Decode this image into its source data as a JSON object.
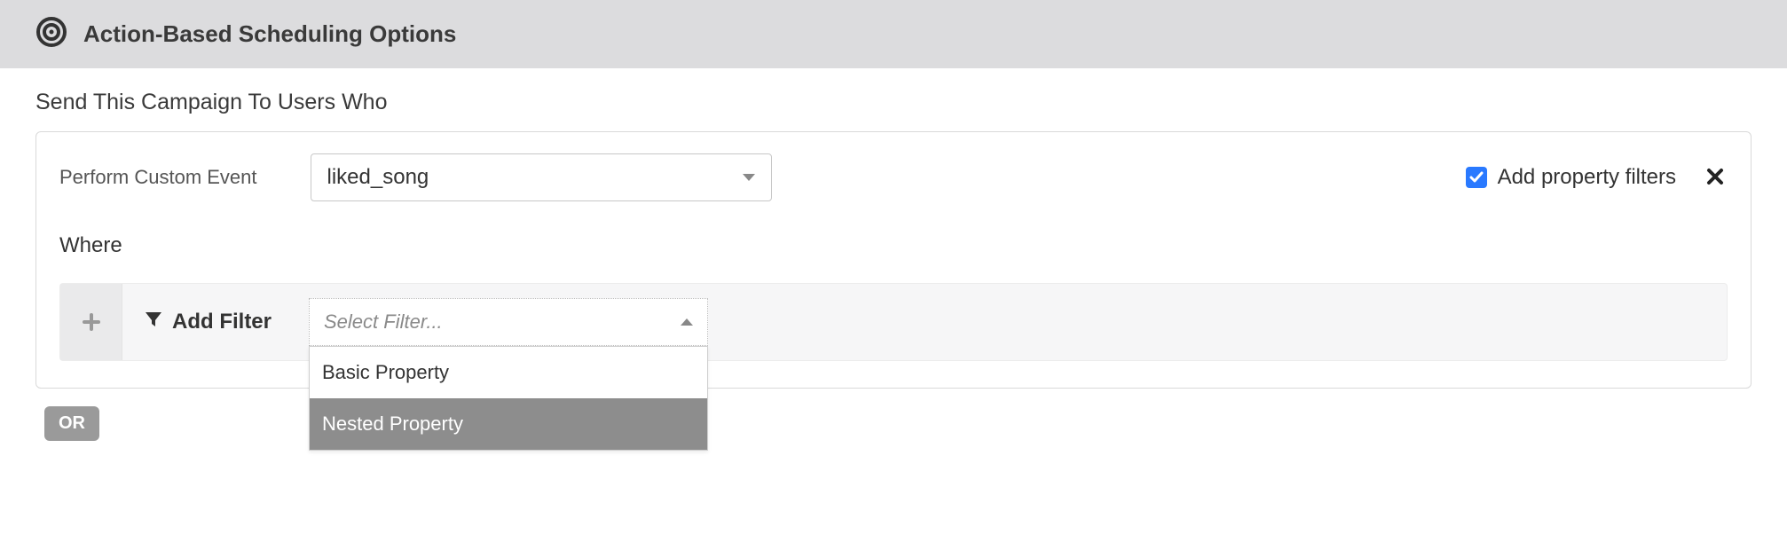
{
  "header": {
    "title": "Action-Based Scheduling Options"
  },
  "section": {
    "send_to_label": "Send This Campaign To Users Who",
    "trigger": {
      "label": "Perform Custom Event",
      "selected_event": "liked_song"
    },
    "property_filters": {
      "checkbox_label": "Add property filters",
      "checked": true
    },
    "where": {
      "label": "Where",
      "add_filter_label": "Add Filter",
      "select_placeholder": "Select Filter...",
      "options": [
        "Basic Property",
        "Nested Property"
      ],
      "highlighted_index": 1
    },
    "or_label": "OR"
  }
}
